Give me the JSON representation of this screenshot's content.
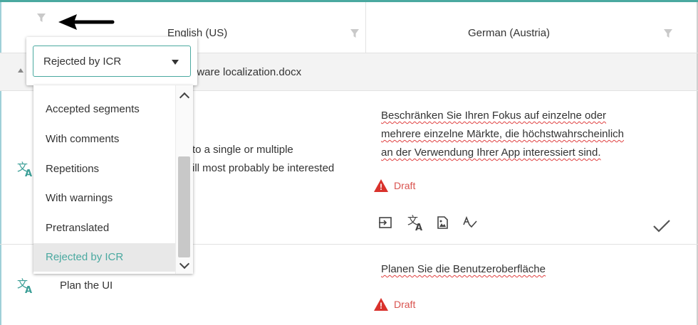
{
  "columns": {
    "source_header": "English (US)",
    "target_header": "German (Austria)"
  },
  "file": {
    "name_visible": "ftware localization.docx"
  },
  "segments": [
    {
      "source_line1": "to a single or multiple",
      "source_line2": "ill most probably be interested",
      "target_line1": "Beschränken Sie Ihren Fokus auf einzelne oder",
      "target_line2": "mehrere einzelne Märkte, die höchstwahrscheinlich",
      "target_line3": "an der Verwendung Ihrer App interessiert sind.",
      "status": "Draft"
    },
    {
      "source_line1": "Plan the UI",
      "target_line1": "Planen Sie die Benutzeroberfläche",
      "status": "Draft"
    }
  ],
  "filter_dropdown": {
    "selected": "Rejected by ICR",
    "options": [
      "Accepted segments",
      "With comments",
      "Repetitions",
      "With warnings",
      "Pretranslated",
      "Rejected by ICR"
    ]
  },
  "colors": {
    "accent": "#4aa9a0",
    "status_red": "#d9534f",
    "spell_underline": "#e04040"
  },
  "icons": [
    "filter-icon",
    "translate-icon",
    "insert-source-icon",
    "machine-translate-icon",
    "image-icon",
    "spellcheck-icon",
    "checkmark-icon",
    "warning-icon",
    "arrow-left-icon"
  ]
}
